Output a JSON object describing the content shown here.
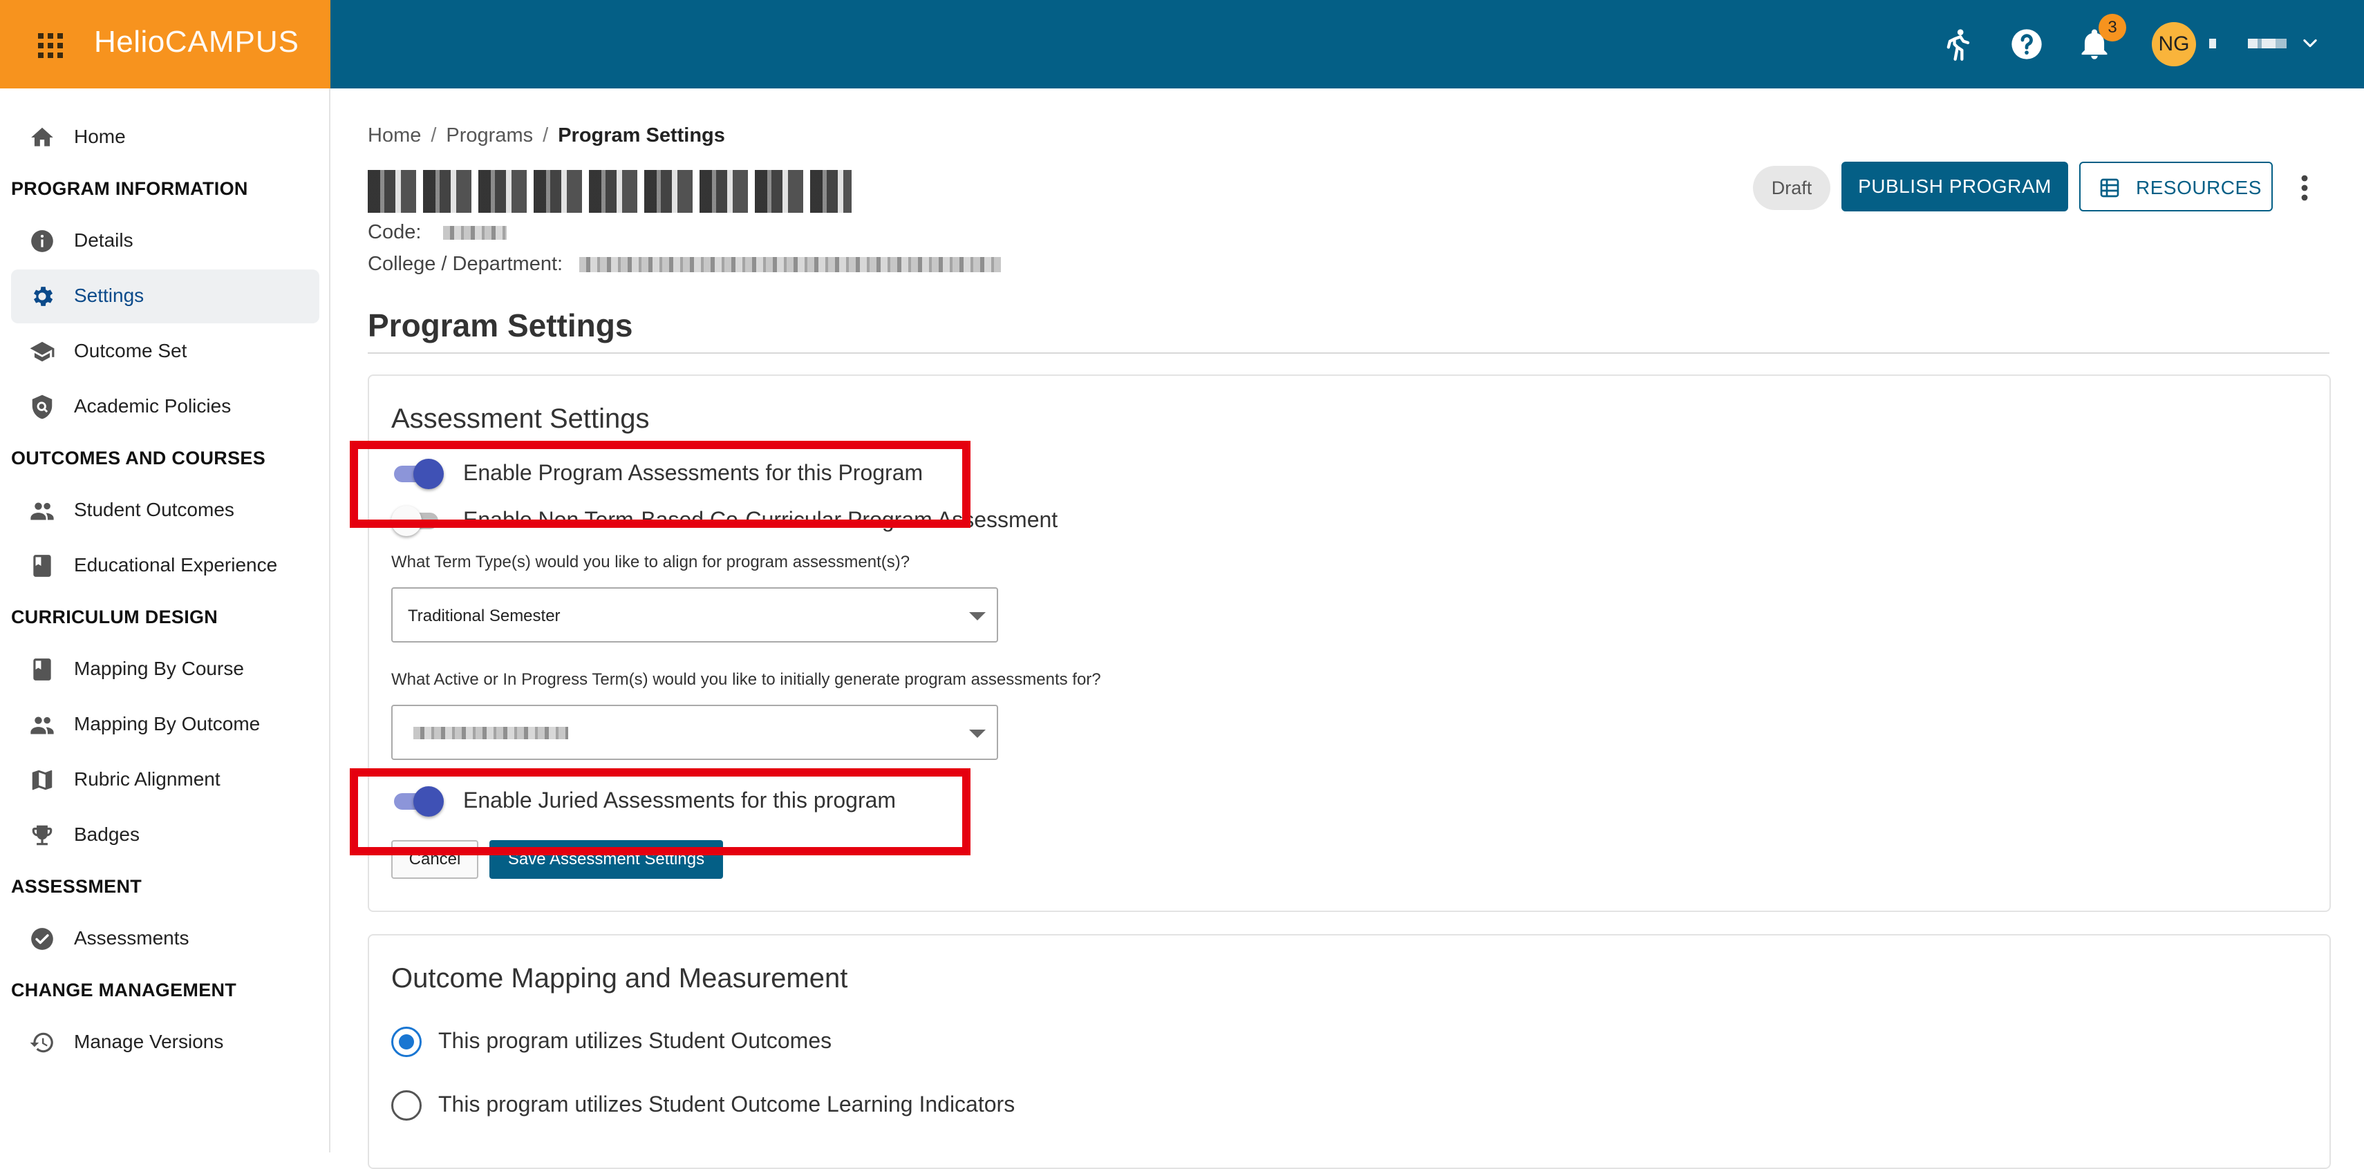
{
  "app": {
    "logo_prefix": "Helio",
    "logo_suffix": "CAMPUS"
  },
  "topbar": {
    "notification_count": "3",
    "user_initials": "NG"
  },
  "sidebar": {
    "home": "Home",
    "sections": {
      "program_information": "PROGRAM INFORMATION",
      "outcomes_and_courses": "OUTCOMES AND COURSES",
      "curriculum_design": "CURRICULUM DESIGN",
      "assessment": "ASSESSMENT",
      "change_management": "CHANGE MANAGEMENT"
    },
    "items": {
      "details": "Details",
      "settings": "Settings",
      "outcome_set": "Outcome Set",
      "academic_policies": "Academic Policies",
      "student_outcomes": "Student Outcomes",
      "educational_experience": "Educational Experience",
      "mapping_by_course": "Mapping By Course",
      "mapping_by_outcome": "Mapping By Outcome",
      "rubric_alignment": "Rubric Alignment",
      "badges": "Badges",
      "assessments": "Assessments",
      "manage_versions": "Manage Versions"
    },
    "active": "settings"
  },
  "breadcrumb": {
    "home": "Home",
    "programs": "Programs",
    "current": "Program Settings"
  },
  "program": {
    "code_label": "Code:",
    "college_label": "College / Department:",
    "status": "Draft"
  },
  "actions": {
    "publish": "PUBLISH PROGRAM",
    "resources": "RESOURCES"
  },
  "page": {
    "title": "Program Settings"
  },
  "assessment_settings": {
    "title": "Assessment Settings",
    "toggle_program_assessments": {
      "label": "Enable Program Assessments for this Program",
      "on": true
    },
    "toggle_non_term": {
      "label": "Enable Non Term-Based Co-Curricular Program Assessment",
      "on": false
    },
    "term_type_question": "What Term Type(s) would you like to align for program assessment(s)?",
    "term_type_value": "Traditional Semester",
    "active_terms_question": "What Active or In Progress Term(s) would you like to initially generate program assessments for?",
    "toggle_juried": {
      "label": "Enable Juried Assessments for this program",
      "on": true
    },
    "cancel": "Cancel",
    "save": "Save Assessment Settings"
  },
  "outcome_mapping": {
    "title": "Outcome Mapping and Measurement",
    "option_student_outcomes": "This program utilizes Student Outcomes",
    "option_learning_indicators": "This program utilizes Student Outcome Learning Indicators",
    "selected": "student_outcomes"
  },
  "colors": {
    "topbar": "#045f86",
    "brand": "#f7931e",
    "highlight": "#e5000f",
    "toggle_on": "#3f51b5"
  }
}
